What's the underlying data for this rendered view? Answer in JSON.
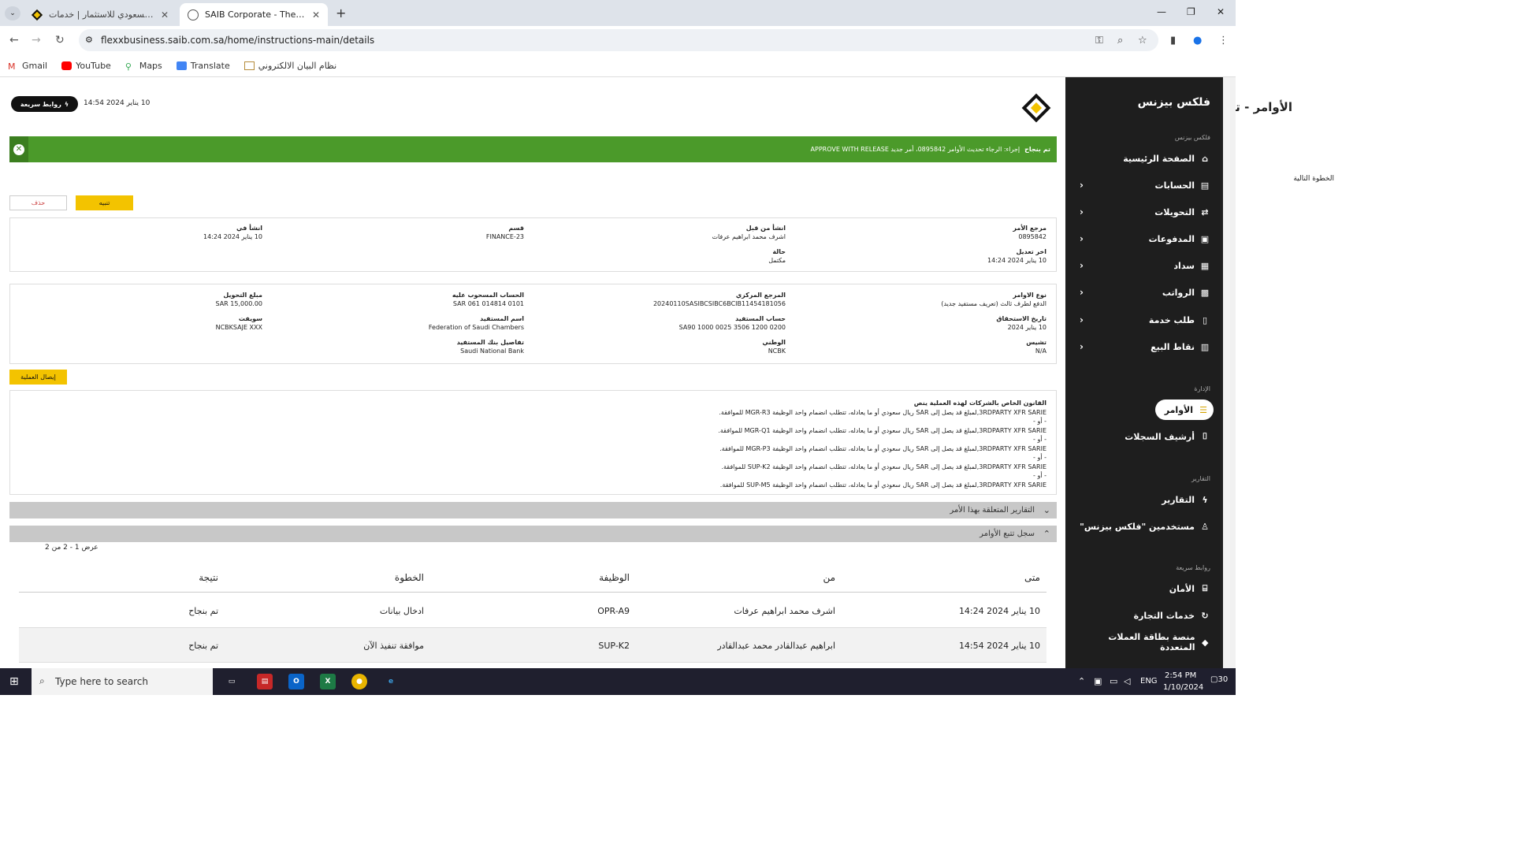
{
  "browser": {
    "tabs": [
      {
        "title": "البنك السعودي للاستثمار | خدمات",
        "active": false
      },
      {
        "title": "SAIB Corporate - The Saudi Inv",
        "active": true
      }
    ],
    "url": "flexxbusiness.saib.com.sa/home/instructions-main/details",
    "bookmarks": [
      "Gmail",
      "YouTube",
      "Maps",
      "Translate",
      "نظام البيان الالكتروني"
    ]
  },
  "sidebar": {
    "title": "فلكس بيزنس",
    "sections": [
      {
        "label": "فلكس بيزنس",
        "items": [
          {
            "label": "الصفحة الرئيسية",
            "icon": "home-icon"
          },
          {
            "label": "الحسابات",
            "icon": "accounts-icon",
            "chevron": true
          },
          {
            "label": "التحويلات",
            "icon": "transfer-icon",
            "chevron": true
          },
          {
            "label": "المدفوعات",
            "icon": "payments-icon",
            "chevron": true
          },
          {
            "label": "سداد",
            "icon": "sadad-icon",
            "chevron": true
          },
          {
            "label": "الرواتب",
            "icon": "payroll-icon",
            "chevron": true
          },
          {
            "label": "طلب خدمة",
            "icon": "service-request-icon",
            "chevron": true
          },
          {
            "label": "نقاط البيع",
            "icon": "pos-icon",
            "chevron": true
          }
        ]
      },
      {
        "label": "الإدارة",
        "items": [
          {
            "label": "الأوامر",
            "icon": "list-icon",
            "active": true
          },
          {
            "label": "أرشيف السجلات",
            "icon": "archive-icon"
          }
        ]
      },
      {
        "label": "التقارير",
        "items": [
          {
            "label": "التقارير",
            "icon": "reports-icon"
          },
          {
            "label": "مستخدمين \"فلكس بيزنس\"",
            "icon": "users-icon"
          }
        ]
      },
      {
        "label": "روابط سريعة",
        "items": [
          {
            "label": "الأمان",
            "icon": "lock-icon"
          },
          {
            "label": "خدمات التجارة",
            "icon": "trade-icon"
          },
          {
            "label": "منصة بطاقة العملات المتعددة",
            "icon": "card-icon"
          }
        ]
      }
    ]
  },
  "header": {
    "title": "الأوامر - تفاصيل الأوامر",
    "quick_links": "روابط سريعة",
    "datetime": "10 يناير 2024  14:54"
  },
  "banner": {
    "status": "تم بنجاح",
    "message": "إجراء: الرجاء تحديث الأوامر 0895842، أمر جديد APPROVE WITH RELEASE"
  },
  "next_step": "الخطوة التالية",
  "buttons": {
    "alert": "تنبيه",
    "delete": "حذف",
    "receipt": "إيصال العملية"
  },
  "summary": {
    "order_ref": {
      "label": "مرجع الأمر",
      "value": "0895842"
    },
    "created_by": {
      "label": "انشأ من قبل",
      "value": "اشرف محمد ابراهيم عرفات"
    },
    "department": {
      "label": "قسم",
      "value": "FINANCE-23"
    },
    "created_at": {
      "label": "انشأ في",
      "value": "10 يناير 2024 14:24"
    },
    "last_modified": {
      "label": "اخر تعديل",
      "value": "10 يناير 2024 14:24"
    },
    "status": {
      "label": "حالة",
      "value": "مكتمل"
    }
  },
  "details": {
    "order_type": {
      "label": "نوع الاوامر",
      "value": "الدفع لطرف ثالث (تعريف مستفيد جديد)"
    },
    "central_ref": {
      "label": "المرجع المركزي",
      "value": "20240110SASIBCSIBC6BCIB11454181056"
    },
    "debit_account": {
      "label": "الحساب المسحوب عليه",
      "value": "0101 014814 061 SAR"
    },
    "amount": {
      "label": "مبلغ التحويل",
      "value": "SAR 15,000.00"
    },
    "value_date": {
      "label": "تاريخ الاستحقاق",
      "value": "10 يناير 2024"
    },
    "beneficiary_account": {
      "label": "حساب المستفيد",
      "value": "SA90 1000 0025 3506 1200 0200"
    },
    "beneficiary_name": {
      "label": "اسم المستفيد",
      "value": "Federation of Saudi Chambers"
    },
    "swift": {
      "label": "سويفت",
      "value": "NCBKSAJE XXX"
    },
    "chips": {
      "label": "تشيس",
      "value": "N/A"
    },
    "national": {
      "label": "الوطني",
      "value": "NCBK"
    },
    "beneficiary_bank": {
      "label": "تفاصيل بنك المستفيد",
      "value": "Saudi National Bank"
    }
  },
  "rules": {
    "title": "القانون الخاص بالشركات لهذه العملية ينص",
    "lines": [
      "3RDPARTY XFR SARIE,لمبلغ قد يصل إلى SAR ريال سعودي أو ما يعادله، تتطلب انضمام واحد الوظيفة MGR-R3 للموافقة.",
      "- أو -",
      "3RDPARTY XFR SARIE,لمبلغ قد يصل إلى SAR ريال سعودي أو ما يعادله، تتطلب انضمام واحد الوظيفة MGR-Q1 للموافقة.",
      "- أو -",
      "3RDPARTY XFR SARIE,لمبلغ قد يصل إلى SAR ريال سعودي أو ما يعادله، تتطلب انضمام واحد الوظيفة MGR-P3 للموافقة.",
      "- أو -",
      "3RDPARTY XFR SARIE,لمبلغ قد يصل إلى SAR ريال سعودي أو ما يعادله، تتطلب انضمام واحد الوظيفة SUP-K2 للموافقة.",
      "- أو -",
      "3RDPARTY XFR SARIE,لمبلغ قد يصل إلى SAR ريال سعودي أو ما يعادله، تتطلب انضمام واحد الوظيفة SUP-M5 للموافقة."
    ]
  },
  "related_reports": "التقارير المتعلقة بهذا الأمر",
  "tracking": {
    "title": "سجل تتبع الأوامر",
    "pager": "عرض 1 - 2 من 2",
    "headers": [
      "متى",
      "من",
      "الوظيفة",
      "الخطوة",
      "نتيجة"
    ],
    "rows": [
      [
        "10 يناير 2024 14:24",
        "اشرف محمد ابراهيم عرفات",
        "OPR-A9",
        "ادخال بيانات",
        "تم بنجاح"
      ],
      [
        "10 يناير 2024 14:54",
        "ابراهيم عبدالقادر محمد عبدالقادر",
        "SUP-K2",
        "موافقة تنفيذ الآن",
        "تم بنجاح"
      ]
    ]
  },
  "taskbar": {
    "search_placeholder": "Type here to search",
    "lang": "ENG",
    "time": "2:54 PM",
    "date": "1/10/2024",
    "notifications": "30"
  },
  "colors": {
    "accent": "#f3c300",
    "success": "#4b9a2a",
    "sidebar": "#1e1e1e"
  }
}
